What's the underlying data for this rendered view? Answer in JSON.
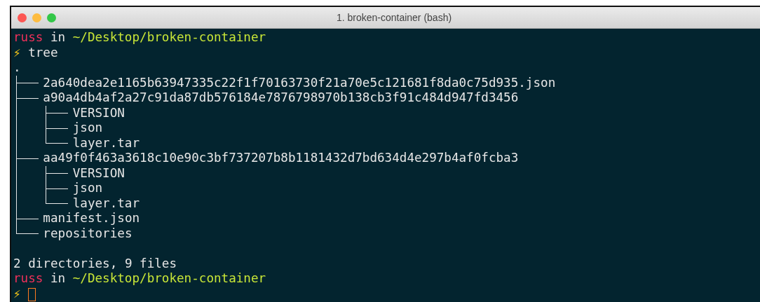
{
  "window": {
    "title": "1. broken-container (bash)"
  },
  "lines": [
    {
      "kind": "prompt",
      "user": "russ",
      "word": "in",
      "path": "~/Desktop/broken-container"
    },
    {
      "kind": "command",
      "symbol": "⚡",
      "text": "tree"
    },
    {
      "kind": "tree",
      "root": ".",
      "children": [
        {
          "name": "2a640dea2e1165b63947335c22f1f70163730f21a70e5c121681f8da0c75d935.json"
        },
        {
          "name": "a90a4db4af2a27c91da87db576184e7876798970b138cb3f91c484d947fd3456",
          "children": [
            {
              "name": "VERSION"
            },
            {
              "name": "json"
            },
            {
              "name": "layer.tar"
            }
          ]
        },
        {
          "name": "aa49f0f463a3618c10e90c3bf737207b8b1181432d7bd634d4e297b4af0fcba3",
          "children": [
            {
              "name": "VERSION"
            },
            {
              "name": "json"
            },
            {
              "name": "layer.tar"
            }
          ]
        },
        {
          "name": "manifest.json"
        },
        {
          "name": "repositories"
        }
      ]
    },
    {
      "kind": "blank"
    },
    {
      "kind": "text",
      "text": "2 directories, 9 files"
    },
    {
      "kind": "prompt",
      "user": "russ",
      "word": "in",
      "path": "~/Desktop/broken-container"
    },
    {
      "kind": "input",
      "symbol": "⚡",
      "cursor": true
    }
  ]
}
